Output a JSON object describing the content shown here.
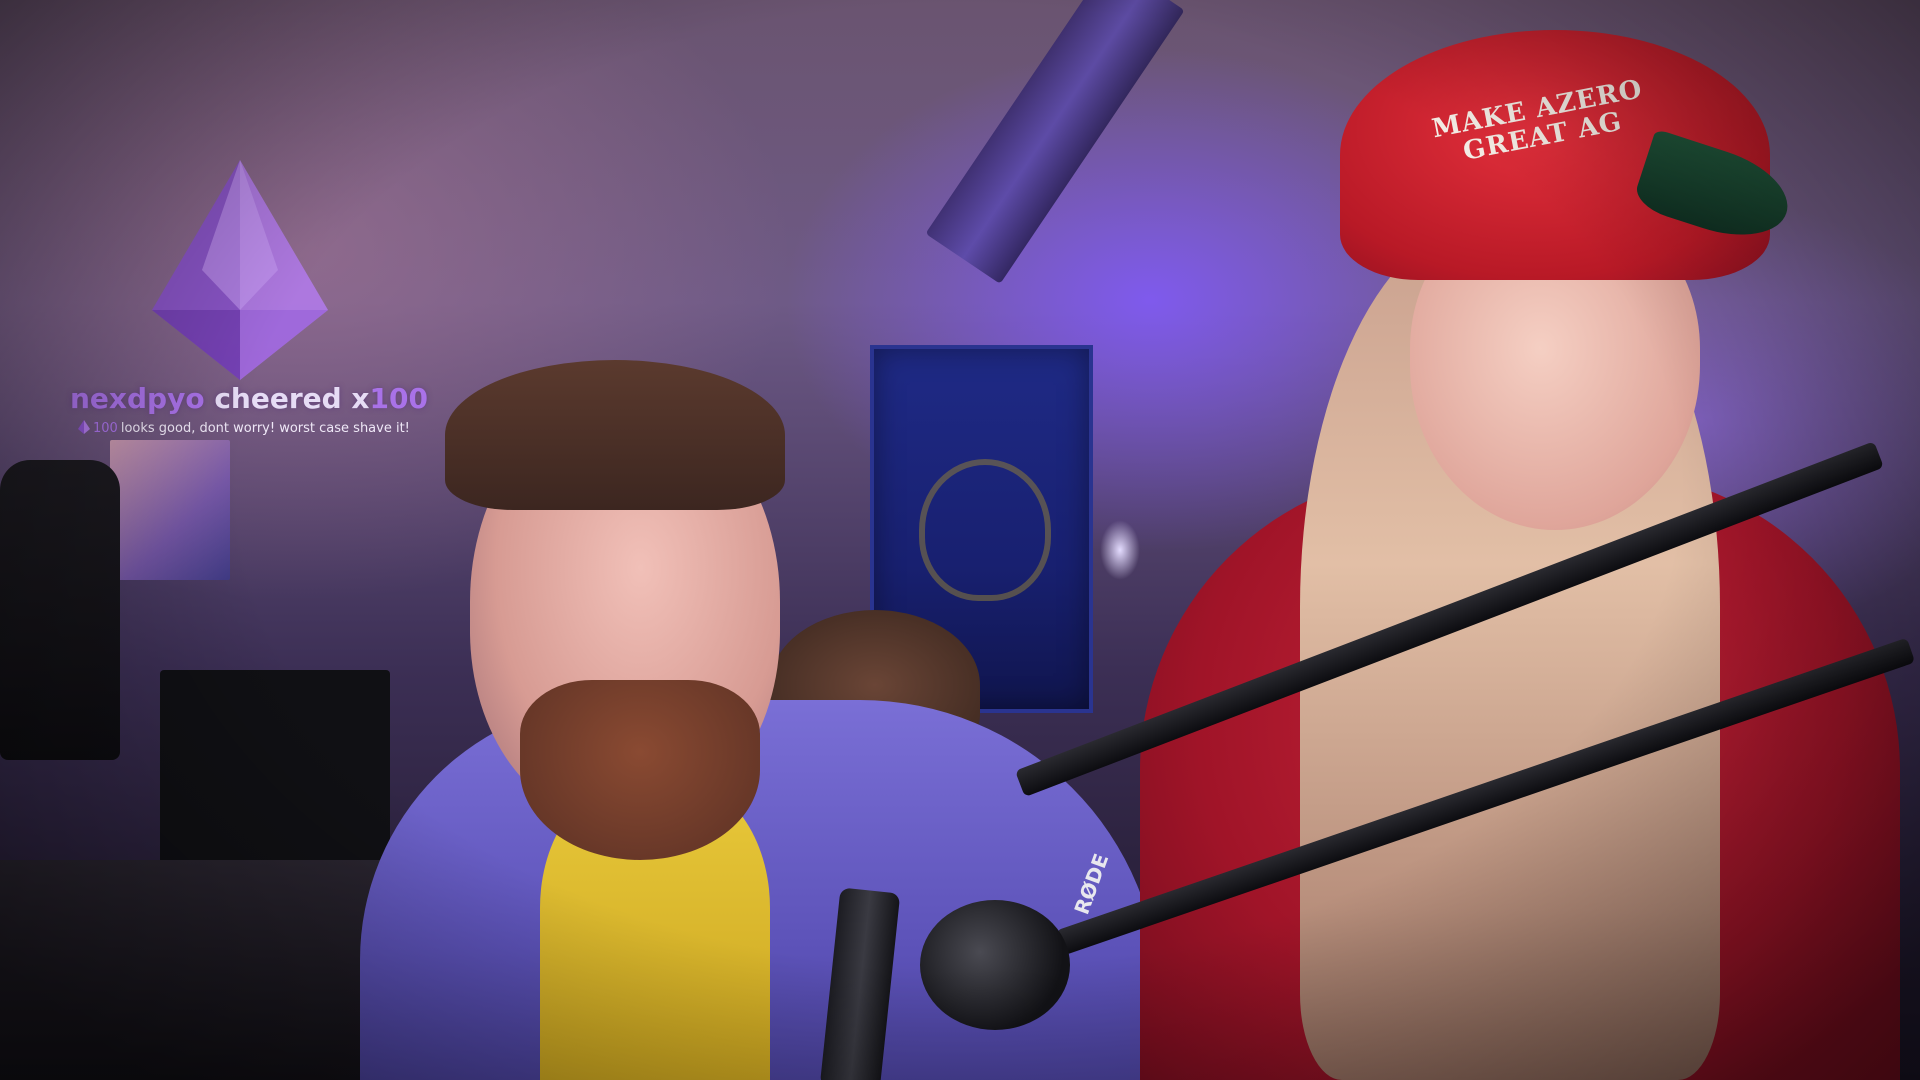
{
  "stream": {
    "scene": "webcam-feed"
  },
  "cheer_alert": {
    "username": "nexdpyo",
    "verb": "cheered",
    "multiplier_prefix": "x",
    "amount": "100",
    "message_bits": "100",
    "message_text": "looks good, dont worry! worst case shave it!",
    "gem_icon": "bits-gem-icon",
    "colors": {
      "username": "#a972e8",
      "amount": "#a972e8",
      "text": "#e6dcf5",
      "gem": "#9b5fd8"
    }
  },
  "scene_text": {
    "cap_line_1": "MAKE AZERO",
    "cap_line_2": "GREAT AG",
    "mic_brand": "RØDE"
  }
}
